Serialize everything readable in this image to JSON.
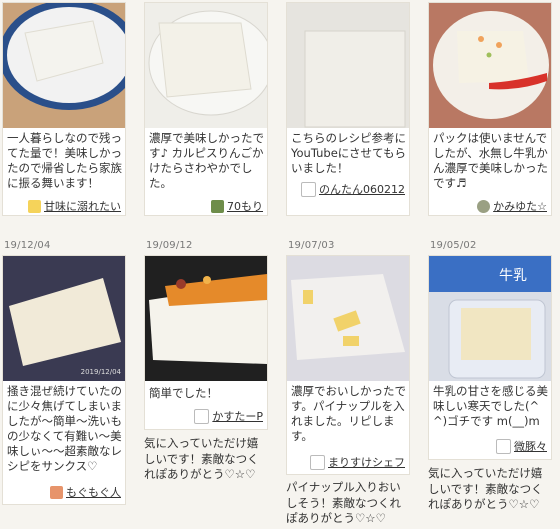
{
  "cards": [
    {
      "date": "",
      "text": "一人暮らしなので残ってた量で！美味しかったので帰省したら家族に振る舞います！",
      "author": "甘味に溺れたい",
      "colors": {
        "bg": "#c9a27a",
        "plate": "#f2f2f2",
        "rim": "#2a4f8a",
        "block": "#f4f3ee"
      }
    },
    {
      "date": "",
      "text": "濃厚で美味しかったです♪ カルピスりんごかけたらさわやかでした。",
      "author": "70もり",
      "colors": {
        "bg": "#efeee9",
        "plate": "#f7f7f4",
        "block": "#f3f1e8"
      }
    },
    {
      "date": "",
      "text": "こちらのレシピ参考にYouTubeにさせてもらいました！",
      "author": "のんたん060212",
      "colors": {
        "bg": "#e6e4df",
        "block": "#f0eee8"
      }
    },
    {
      "date": "",
      "text": "パックは使いませんでしたが、水無し牛乳かん濃厚で美味しかったです♬",
      "author": "かみゆた☆",
      "colors": {
        "bg": "#b97863",
        "plate": "#f3efe8",
        "block": "#f6f2e4",
        "spoon": "#d8322a"
      }
    },
    {
      "date": "19/12/04",
      "text": "掻き混ぜ続けていたのに少々焦げてしまいましたが～簡単～洗いもの少なくて有難い～美味しぃ～～超素敵なレシピをサンクス♡",
      "author": "もぐもぐ人",
      "watermark": "2019/12/04",
      "colors": {
        "bg": "#3a3a52",
        "block": "#f1ead8"
      }
    },
    {
      "date": "19/09/12",
      "text": "簡単でした！",
      "author": "かすたーP",
      "under": "気に入っていただけ嬉しいです！素敵なつくれぽありがとう♡☆♡",
      "colors": {
        "bg": "#202020",
        "block": "#f5f3ec",
        "topping": "#e58a2a"
      }
    },
    {
      "date": "19/07/03",
      "text": "濃厚でおいしかったです。パイナップルを入れました。リピします。",
      "author": "まりすけシェフ",
      "under": "パイナップル入りおいしそう！素敵なつくれぽありがとう♡☆♡",
      "colors": {
        "bg": "#dcdbe2",
        "block": "#f2f0ee",
        "fruit": "#f1d26a"
      }
    },
    {
      "date": "19/05/02",
      "text": "牛乳の甘さを感じる美味しい寒天でした(^^)ゴチです m(__)m",
      "author": "微豚々",
      "under": "気に入っていただけ嬉しいです！素敵なつくれぽありがとう♡☆♡",
      "milk_label": "牛乳",
      "colors": {
        "bg": "#d9dde6",
        "block": "#f1e6c2",
        "carton": "#3a6fc4"
      }
    }
  ]
}
